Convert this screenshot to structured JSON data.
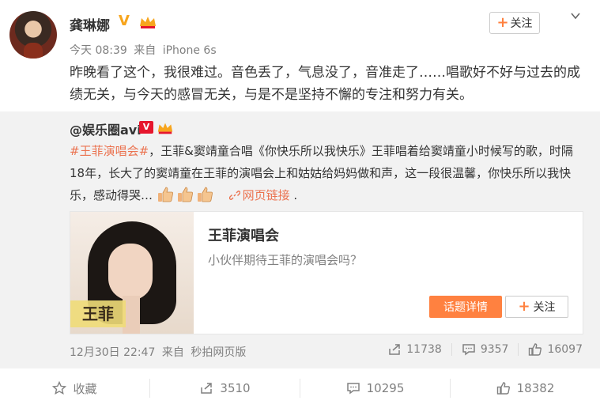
{
  "post": {
    "username": "龚琳娜",
    "meta": {
      "time": "今天 08:39",
      "source_prefix": "来自",
      "source": "iPhone 6s"
    },
    "follow_label": "关注",
    "content": "昨晚看了这个，我很难过。音色丢了，气息没了，音准走了……唱歌好不好与过去的成绩无关，与今天的感冒无关，与是不是坚持不懈的专注和努力有关。"
  },
  "repost": {
    "username": "@娱乐圈avi",
    "hashtag": "#王菲演唱会#",
    "text": "，王菲&窦靖童合唱《你快乐所以我快乐》王菲唱着给窦靖童小时候写的歌，时隔18年，长大了的窦靖童在王菲的演唱会上和姑姑给妈妈做和声，这一段很温馨，你快乐所以我快乐，感动得哭…",
    "link_label": "网页链接",
    "link_suffix": ".",
    "card": {
      "image_label": "王菲",
      "title": "王菲演唱会",
      "description": "小伙伴期待王菲的演唱会吗？",
      "topic_button": "话题详情",
      "follow_label": "关注"
    },
    "meta": {
      "time": "12月30日 22:47",
      "source_prefix": "来自",
      "source": "秒拍网页版"
    },
    "stats": {
      "reposts": "11738",
      "comments": "9357",
      "likes": "16097"
    }
  },
  "actions": {
    "favorite": "收藏",
    "repost": "3510",
    "comment": "10295",
    "like": "18382"
  },
  "colors": {
    "accent": "#ff8140",
    "link": "#eb7350",
    "verified": "#f7a51d",
    "text": "#333333",
    "muted": "#808080"
  }
}
